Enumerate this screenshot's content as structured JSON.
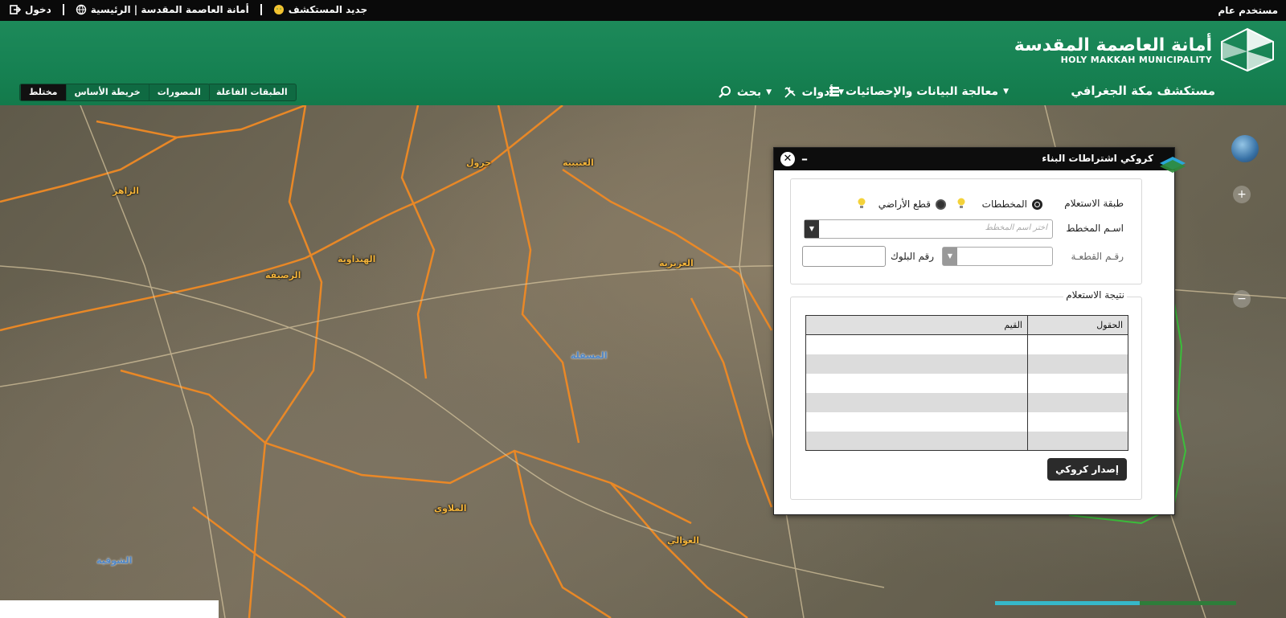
{
  "topbar": {
    "user": "مستخدم عام",
    "links": [
      "جديد المستكشف",
      "أمانة العاصمة المقدسة | الرئيسية",
      "دخول"
    ]
  },
  "header": {
    "brand_ar": "أمانة العاصمة المقدسة",
    "brand_en": "HOLY MAKKAH MUNICIPALITY",
    "app_title": "مستكشف مكة الجغرافي",
    "menu": {
      "data": "معالجة البيانات والإحصائيات",
      "tools": "أدوات",
      "search": "بحث"
    },
    "active_layers": "الطبقات الفاعلة",
    "basemaps": [
      "المصورات",
      "خريطة الأساس",
      "مختلط"
    ],
    "active_basemap": "مختلط"
  },
  "dialog": {
    "title": "كروكي اشتراطات البناء",
    "query_layer_label": "طبقة الاستعلام",
    "options": [
      "المخططات",
      "قطع الأراضي"
    ],
    "plan_name_label": "اسـم المخطط",
    "plan_name_placeholder": "اختر اسم المخطط",
    "parcel_no_label": "رقـم القطعـة",
    "block_no_label": "رقم البلوك",
    "result_legend": "نتيجة الاستعلام",
    "columns": [
      "الحقول",
      "القيم"
    ],
    "issue_button": "إصدار كروكي"
  },
  "map": {
    "districts": [
      "الزاهر",
      "العتيبية",
      "جرول",
      "المسفلة",
      "العزيزية",
      "الشوقية",
      "العوالي",
      "الرصيفة",
      "الهنداوية",
      "الملاوي"
    ]
  }
}
